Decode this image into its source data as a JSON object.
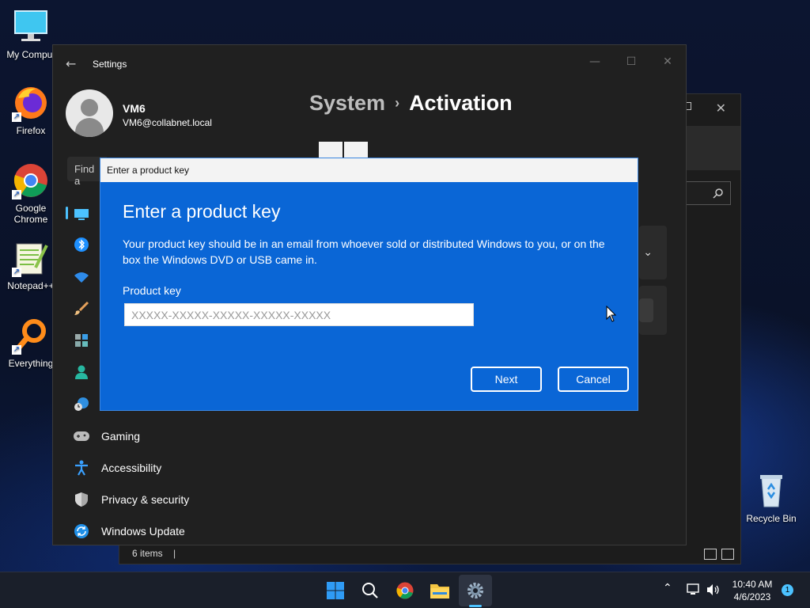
{
  "desktop": {
    "icons": [
      {
        "label": "My Comput"
      },
      {
        "label": "Firefox"
      },
      {
        "label": "Google Chrome"
      },
      {
        "label": "Notepad++"
      },
      {
        "label": "Everything"
      },
      {
        "label": "Recycle Bin"
      }
    ]
  },
  "explorer": {
    "status_items": "6 items"
  },
  "settings": {
    "title": "Settings",
    "user_name": "VM6",
    "user_email": "VM6@collabnet.local",
    "breadcrumb": {
      "parent": "System",
      "current": "Activation"
    },
    "find_placeholder": "Find a",
    "nav": [
      {
        "label": "Gaming"
      },
      {
        "label": "Accessibility"
      },
      {
        "label": "Privacy & security"
      },
      {
        "label": "Windows Update"
      }
    ]
  },
  "dialog": {
    "title": "Enter a product key",
    "heading": "Enter a product key",
    "description": "Your product key should be in an email from whoever sold or distributed Windows to you, or on the box the Windows DVD or USB came in.",
    "field_label": "Product key",
    "field_placeholder": "XXXXX-XXXXX-XXXXX-XXXXX-XXXXX",
    "field_value": "",
    "next_label": "Next",
    "cancel_label": "Cancel"
  },
  "taskbar": {
    "time": "10:40 AM",
    "date": "4/6/2023",
    "notification_count": "1"
  },
  "colors": {
    "accent": "#0a66d6",
    "selection": "#4cc2ff"
  }
}
